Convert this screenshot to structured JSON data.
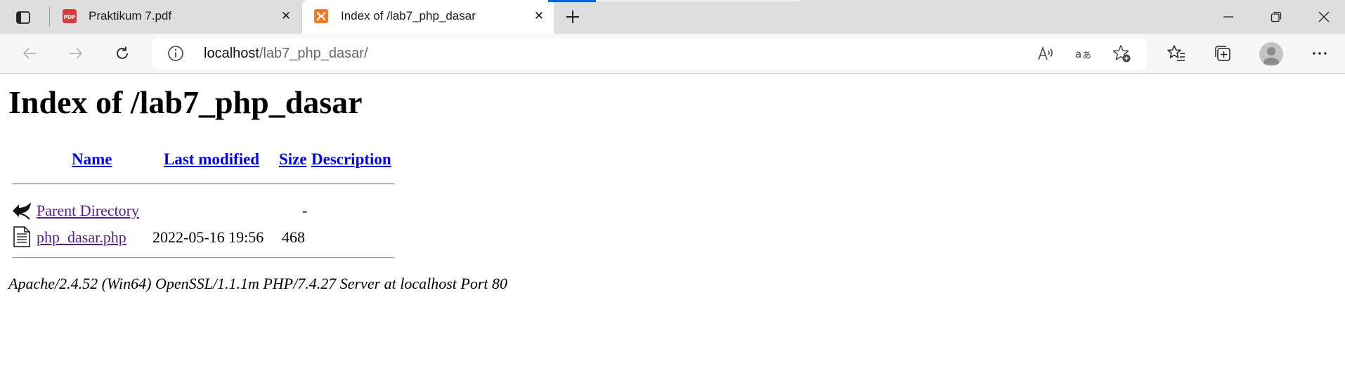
{
  "browser": {
    "tabs": [
      {
        "title": "Praktikum 7.pdf",
        "favicon": "pdf-icon",
        "favicon_text": "PDF",
        "active": false
      },
      {
        "title": "Index of /lab7_php_dasar",
        "favicon": "xampp-icon",
        "active": true
      }
    ],
    "address": {
      "host": "localhost",
      "path": "/lab7_php_dasar/"
    },
    "colors": {
      "tab_strip": "#dedede",
      "toolbar": "#f7f7f7",
      "loading_bar": "#0a66d6",
      "pdf_favicon": "#d93c3c",
      "xampp_favicon": "#f27a24"
    }
  },
  "page": {
    "title": "Index of /lab7_php_dasar",
    "columns": {
      "name": "Name",
      "last_modified": "Last modified",
      "size": "Size",
      "description": "Description"
    },
    "rows": [
      {
        "icon": "back-arrow-icon",
        "name": "Parent Directory",
        "last_modified": "",
        "size": "-",
        "description": ""
      },
      {
        "icon": "text-file-icon",
        "name": "php_dasar.php",
        "last_modified": "2022-05-16 19:56",
        "size": "468",
        "description": ""
      }
    ],
    "server_signature": "Apache/2.4.52 (Win64) OpenSSL/1.1.1m PHP/7.4.27 Server at localhost Port 80",
    "colors": {
      "link": "#0000ee",
      "visited_link": "#551a8b"
    }
  }
}
